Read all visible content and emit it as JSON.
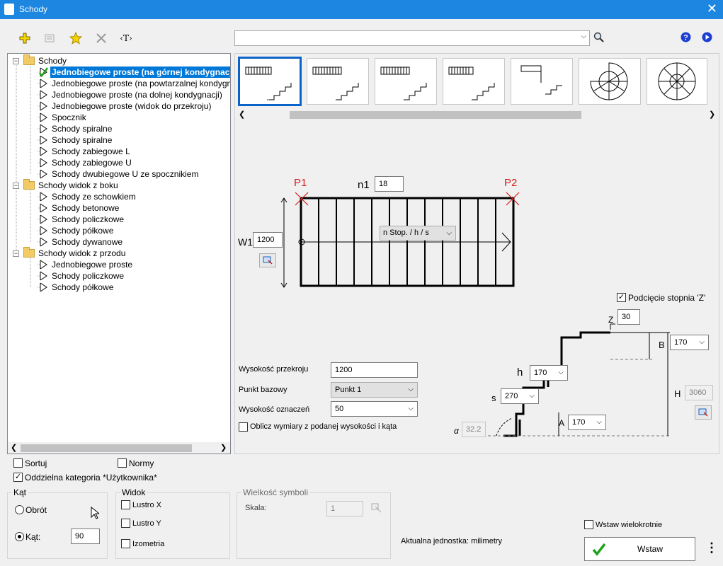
{
  "window": {
    "title": "Schody"
  },
  "toolbar": {
    "icons": [
      "add-icon",
      "properties-icon",
      "favorite-star-icon",
      "delete-icon",
      "text-tag-icon"
    ],
    "text_tag": "‹T›",
    "search_value": ""
  },
  "tree": {
    "groups": [
      {
        "label": "Schody",
        "items": [
          "Jednobiegowe proste (na górnej kondygnacji)",
          "Jednobiegowe proste (na powtarzalnej kondygnacji)",
          "Jednobiegowe proste (na dolnej kondygnacji)",
          "Jednobiegowe proste (widok do przekroju)",
          "Spocznik",
          "Schody spiralne",
          "Schody spiralne",
          "Schody zabiegowe L",
          "Schody zabiegowe U",
          "Schody dwubiegowe U ze spocznikiem"
        ]
      },
      {
        "label": "Schody widok z boku",
        "items": [
          "Schody ze schowkiem",
          "Schody betonowe",
          "Schody policzkowe",
          "Schody półkowe",
          "Schody dywanowe"
        ]
      },
      {
        "label": "Schody widok z przodu",
        "items": [
          "Jednobiegowe proste",
          "Schody policzkowe",
          "Schody półkowe"
        ]
      }
    ],
    "selected": "Jednobiegowe proste (na górnej kondygnacji)"
  },
  "plan": {
    "p1": "P1",
    "p2": "P2",
    "n1_label": "n1",
    "n1_value": "18",
    "w1_label": "W1",
    "w1_value": "1200",
    "mode_combo": "n Stop. / h / s"
  },
  "section": {
    "cut_label": "Podcięcie stopnia 'Z'",
    "cut_checked": true,
    "z_label": "Z",
    "z_value": "30",
    "b_label": "B",
    "b_value": "170",
    "h_label": "h",
    "h_value": "170",
    "s_label": "s",
    "s_value": "270",
    "A_label": "A",
    "A_value": "170",
    "H_label": "H",
    "H_value": "3060",
    "alpha_label": "α",
    "alpha_value": "32.2"
  },
  "params": {
    "wys_przekroju_label": "Wysokość przekroju",
    "wys_przekroju_value": "1200",
    "punkt_bazowy_label": "Punkt bazowy",
    "punkt_bazowy_value": "Punkt 1",
    "wys_oznaczen_label": "Wysokość oznaczeń",
    "wys_oznaczen_value": "50",
    "oblicz_label": "Oblicz wymiary z podanej wysokości i kąta"
  },
  "options": {
    "sortuj": "Sortuj",
    "normy": "Normy",
    "oddzielna": "Oddzielna kategoria *Użytkownika*"
  },
  "kat": {
    "title": "Kąt",
    "obrot": "Obrót",
    "kat_label": "Kąt:",
    "kat_value": "90"
  },
  "widok": {
    "title": "Widok",
    "lustro_x": "Lustro X",
    "lustro_y": "Lustro Y",
    "izometria": "Izometria"
  },
  "symbole": {
    "title": "Wielkość symboli",
    "skala_label": "Skala:",
    "skala_value": "1"
  },
  "footer": {
    "unit": "Aktualna jednostka: milimetry",
    "wstaw_wiele": "Wstaw wielokrotnie",
    "wstaw": "Wstaw",
    "more": "⋮"
  }
}
